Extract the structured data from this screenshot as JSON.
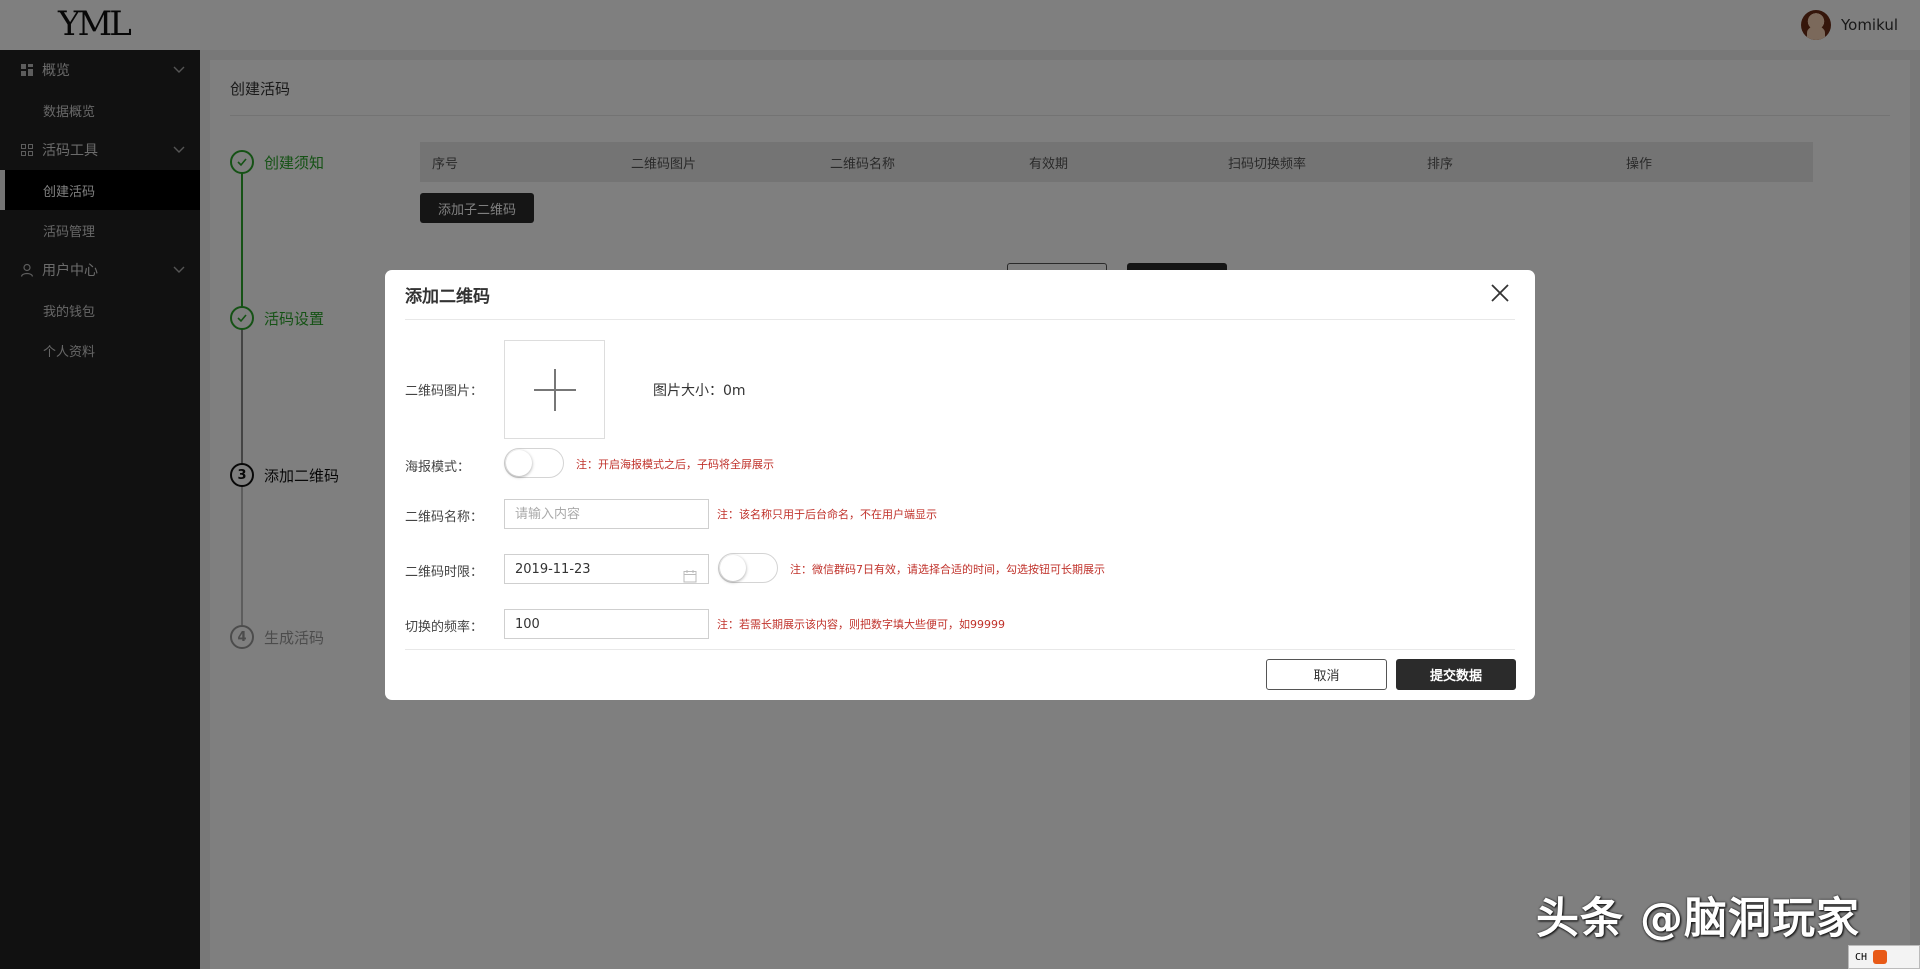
{
  "header": {
    "logo": "YML",
    "user_name": "Yomikul"
  },
  "sidebar": {
    "groups": [
      {
        "label": "概览",
        "icon": "grid-icon",
        "items": [
          "数据概览"
        ]
      },
      {
        "label": "活码工具",
        "icon": "apps-icon",
        "items": [
          "创建活码",
          "活码管理"
        ],
        "active_item": "创建活码"
      },
      {
        "label": "用户中心",
        "icon": "user-icon",
        "items": [
          "我的钱包",
          "个人资料"
        ]
      }
    ]
  },
  "main": {
    "page_title": "创建活码",
    "steps": [
      {
        "label": "创建须知",
        "state": "done"
      },
      {
        "label": "活码设置",
        "state": "done"
      },
      {
        "label": "添加二维码",
        "state": "current",
        "number": "3"
      },
      {
        "label": "生成活码",
        "state": "todo",
        "number": "4"
      }
    ],
    "table_headers": [
      "序号",
      "二维码图片",
      "二维码名称",
      "有效期",
      "扫码切换频率",
      "排序",
      "操作"
    ],
    "add_sub_button": "添加子二维码"
  },
  "dialog": {
    "title": "添加二维码",
    "image_label": "二维码图片：",
    "image_size_text": "图片大小：0m",
    "poster_label": "海报模式：",
    "poster_note": "注：开启海报模式之后，子码将全屏展示",
    "poster_enabled": false,
    "name_label": "二维码名称：",
    "name_placeholder": "请输入内容",
    "name_note": "注：该名称只用于后台命名，不在用户端显示",
    "expire_label": "二维码时限：",
    "expire_value": "2019-11-23",
    "expire_toggle_enabled": false,
    "expire_note": "注：微信群码7日有效，请选择合适的时间，勾选按钮可长期展示",
    "freq_label": "切换的频率：",
    "freq_value": "100",
    "freq_note": "注：若需长期展示该内容，则把数字填大些便可，如99999",
    "cancel_label": "取消",
    "submit_label": "提交数据"
  },
  "watermark": "头条 @脑洞玩家",
  "ime": "CH",
  "colors": {
    "step_done": "#2aa52a",
    "note_red": "#c0322b",
    "sidebar_bg": "#232323",
    "dark_button": "#2b2b2b"
  }
}
